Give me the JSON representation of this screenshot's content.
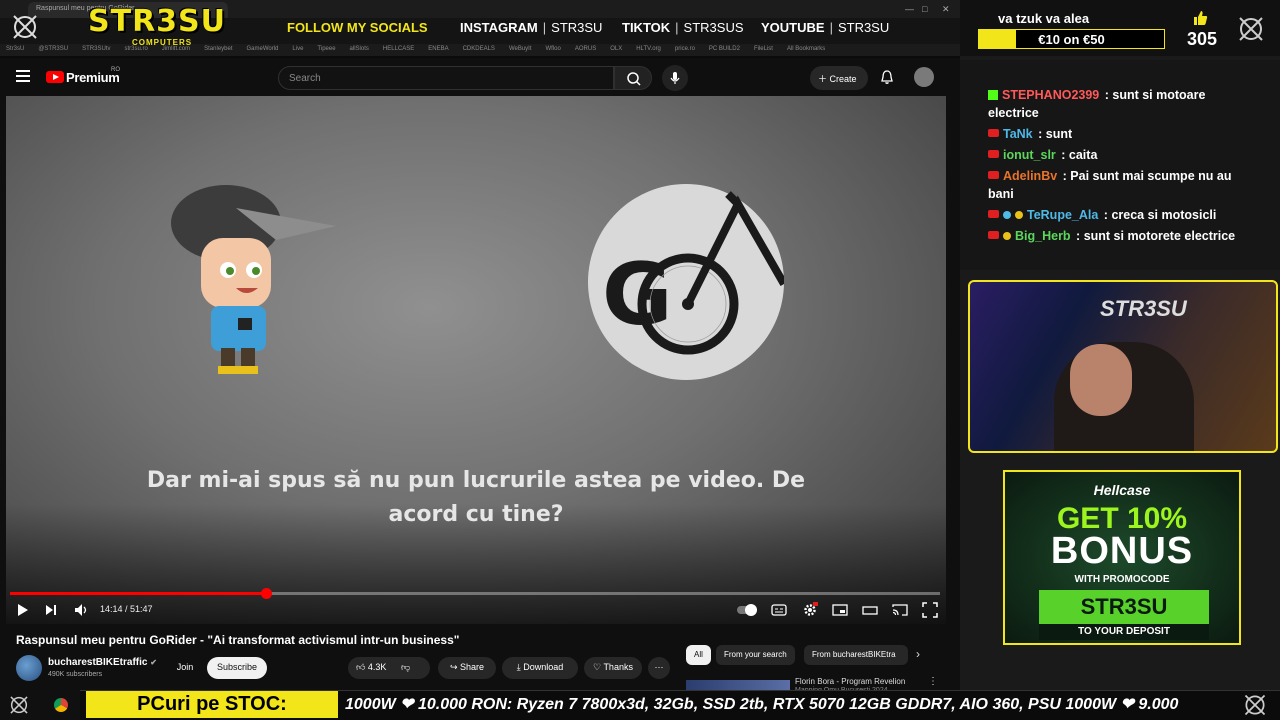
{
  "browser": {
    "tab_title": "Raspunsul meu pentru GoRider...",
    "bookmarks": [
      "Str3sU",
      "@STR3SU",
      "STR3SUtv",
      "str3su.ro",
      "Jimlitt.com",
      "Stanleybet",
      "GameWorld",
      "Live",
      "Tipeee",
      "allSlots",
      "HELLCASE",
      "ENEBA",
      "CDKDEALS",
      "WeBuyIt",
      "Wfloo",
      "AORUS",
      "OLX",
      "HLTV.org",
      "price.ro",
      "PC BUILD2",
      "FileList",
      "All Bookmarks"
    ]
  },
  "overlay": {
    "brand": "STR3SU",
    "brand_sub": "COMPUTERS",
    "follow_label": "FOLLOW MY SOCIALS",
    "socials": [
      {
        "platform": "INSTAGRAM",
        "handle": "STR3SU"
      },
      {
        "platform": "TIKTOK",
        "handle": "STR3SUS"
      },
      {
        "platform": "YOUTUBE",
        "handle": "STR3SU"
      }
    ],
    "goal_title": "va tzuk va alea",
    "goal_label": "€10 on €50",
    "goal_progress": 0.2,
    "like_count": "305",
    "accent_color": "#f2e51a"
  },
  "youtube": {
    "logo_text": "Premium",
    "region": "RO",
    "search_placeholder": "Search",
    "create_label": "Create",
    "subtitle_line1": "Dar mi-ai spus să nu pun lucrurile astea pe video. De",
    "subtitle_line2": "acord cu tine?",
    "time_display": "14:14 / 51:47",
    "progress": 0.275,
    "video_title": "Raspunsul meu pentru GoRider - \"Ai transformat activismul intr-un business\"",
    "channel_name": "bucharestBIKEtraffic",
    "subscribers": "490K subscribers",
    "join_label": "Join",
    "subscribe_label": "Subscribe",
    "likes": "4.3K",
    "share_label": "Share",
    "download_label": "Download",
    "thanks_label": "Thanks",
    "chips": [
      "All",
      "From your search",
      "From bucharestBIKEtra"
    ],
    "rec_title": "Florin Bora - Program Revelion",
    "rec_sub": "Mapping Omu Bucuresti 2024"
  },
  "chat": [
    {
      "user": "STEPHANO2399",
      "text": "sunt si motoare electrice",
      "color": "#ff5a5a",
      "platform": "kick"
    },
    {
      "user": "TaNk",
      "text": "sunt",
      "color": "#4fb9e8",
      "platform": "youtube"
    },
    {
      "user": "ionut_slr",
      "text": "caita",
      "color": "#5cd65c",
      "platform": "youtube"
    },
    {
      "user": "AdelinBv",
      "text": "Pai sunt mai scumpe nu au bani",
      "color": "#e8742c",
      "platform": "youtube"
    },
    {
      "user": "TeRupe_Ala",
      "text": "creca si motosicli",
      "color": "#4fb9e8",
      "platform": "youtube"
    },
    {
      "user": "Big_Herb",
      "text": "sunt si motorete electrice",
      "color": "#5cd65c",
      "platform": "youtube"
    }
  ],
  "webcam": {
    "label": "STR3SU"
  },
  "ad": {
    "brand": "Hellcase",
    "line1": "GET 10%",
    "line2": "BONUS",
    "line3": "WITH PROMOCODE",
    "code": "STR3SU",
    "line4": "TO YOUR DEPOSIT"
  },
  "ticker": {
    "label": "PCuri pe STOC:",
    "text": "1000W ❤ 10.000 RON: Ryzen 7 7800x3d, 32Gb, SSD 2tb, RTX 5070 12GB GDDR7, AIO 360, PSU 1000W ❤ 9.000"
  }
}
